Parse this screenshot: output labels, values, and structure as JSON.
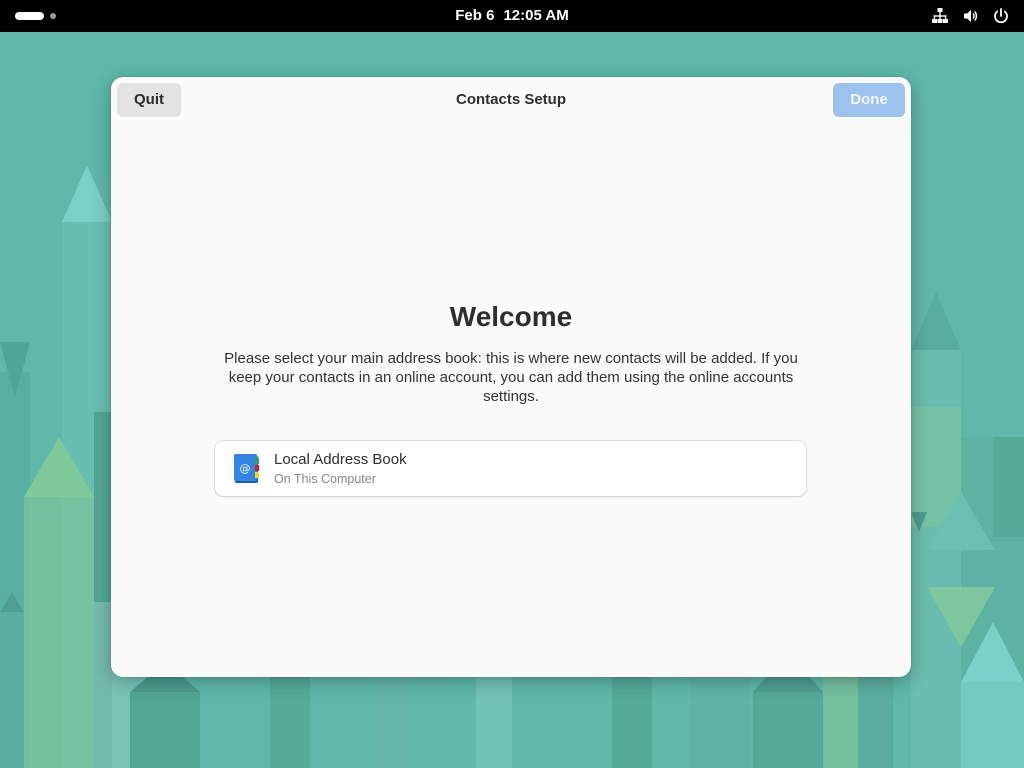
{
  "topbar": {
    "date": "Feb 6",
    "time": "12:05 AM",
    "icons": [
      "network-icon",
      "volume-icon",
      "power-icon"
    ]
  },
  "dialog": {
    "title": "Contacts Setup",
    "quit_label": "Quit",
    "done_label": "Done",
    "heading": "Welcome",
    "description": "Please select your main address book: this is where new contacts will be added. If you keep your contacts in an online account, you can add them using the online accounts settings.",
    "address_books": [
      {
        "name": "Local Address Book",
        "location": "On This Computer",
        "icon": "address-book-icon"
      }
    ]
  },
  "colors": {
    "accent": "#3584e4",
    "done_disabled_bg": "#9cc2ee",
    "wallpaper": "#5fb8aa"
  }
}
